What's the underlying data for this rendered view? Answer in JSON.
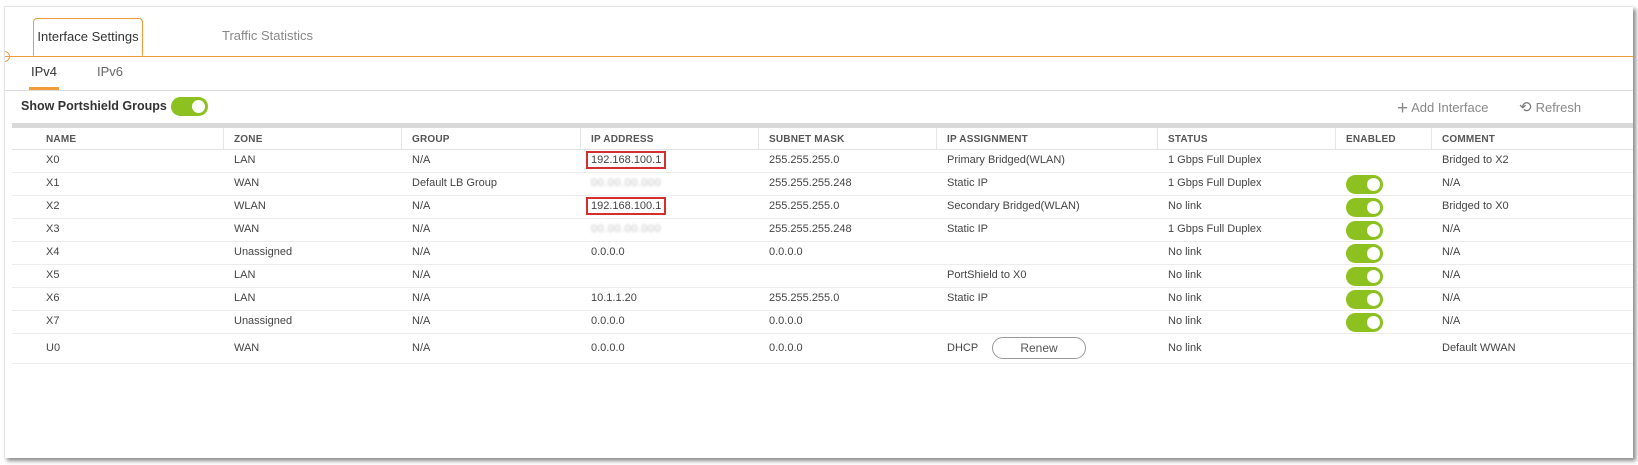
{
  "tabs": {
    "main": [
      "Interface Settings",
      "Traffic Statistics"
    ],
    "sub": [
      "IPv4",
      "IPv6"
    ]
  },
  "toolbar": {
    "show_portshield_label": "Show Portshield Groups",
    "show_portshield_on": true,
    "add_label": "Add Interface",
    "refresh_label": "Refresh"
  },
  "columns": [
    "NAME",
    "ZONE",
    "GROUP",
    "IP ADDRESS",
    "SUBNET MASK",
    "IP ASSIGNMENT",
    "STATUS",
    "ENABLED",
    "COMMENT"
  ],
  "rows": [
    {
      "name": "X0",
      "zone": "LAN",
      "group": "N/A",
      "ip": "192.168.100.1",
      "ip_highlighted": true,
      "mask": "255.255.255.0",
      "assignment": "Primary Bridged(WLAN)",
      "status": "1 Gbps Full Duplex",
      "enabled": null,
      "comment": "Bridged to X2"
    },
    {
      "name": "X1",
      "zone": "WAN",
      "group": "Default LB Group",
      "ip": "00.00.00.000",
      "ip_blurred": true,
      "mask": "255.255.255.248",
      "assignment": "Static IP",
      "status": "1 Gbps Full Duplex",
      "enabled": true,
      "comment": "N/A"
    },
    {
      "name": "X2",
      "zone": "WLAN",
      "group": "N/A",
      "ip": "192.168.100.1",
      "ip_highlighted": true,
      "mask": "255.255.255.0",
      "assignment": "Secondary Bridged(WLAN)",
      "status": "No link",
      "enabled": true,
      "comment": "Bridged to X0"
    },
    {
      "name": "X3",
      "zone": "WAN",
      "group": "N/A",
      "ip": "00.00.00.000",
      "ip_blurred": true,
      "mask": "255.255.255.248",
      "assignment": "Static IP",
      "status": "1 Gbps Full Duplex",
      "enabled": true,
      "comment": "N/A"
    },
    {
      "name": "X4",
      "zone": "Unassigned",
      "group": "N/A",
      "ip": "0.0.0.0",
      "mask": "0.0.0.0",
      "assignment": "",
      "status": "No link",
      "enabled": true,
      "comment": "N/A"
    },
    {
      "name": "X5",
      "zone": "LAN",
      "group": "N/A",
      "ip": "",
      "mask": "",
      "assignment": "PortShield to X0",
      "status": "No link",
      "enabled": true,
      "comment": "N/A"
    },
    {
      "name": "X6",
      "zone": "LAN",
      "group": "N/A",
      "ip": "10.1.1.20",
      "mask": "255.255.255.0",
      "assignment": "Static IP",
      "status": "No link",
      "enabled": true,
      "comment": "N/A"
    },
    {
      "name": "X7",
      "zone": "Unassigned",
      "group": "N/A",
      "ip": "0.0.0.0",
      "mask": "0.0.0.0",
      "assignment": "",
      "status": "No link",
      "enabled": true,
      "comment": "N/A"
    },
    {
      "name": "U0",
      "zone": "WAN",
      "group": "N/A",
      "ip": "0.0.0.0",
      "mask": "0.0.0.0",
      "assignment": "DHCP",
      "renew_label": "Renew",
      "status": "No link",
      "enabled": null,
      "comment": "Default WWAN"
    }
  ],
  "colors": {
    "accent": "#f29b3a",
    "toggle_on": "#8cc11f",
    "highlight": "#d32f2f"
  },
  "icons": {
    "add": "plus-icon",
    "refresh": "refresh-icon"
  }
}
